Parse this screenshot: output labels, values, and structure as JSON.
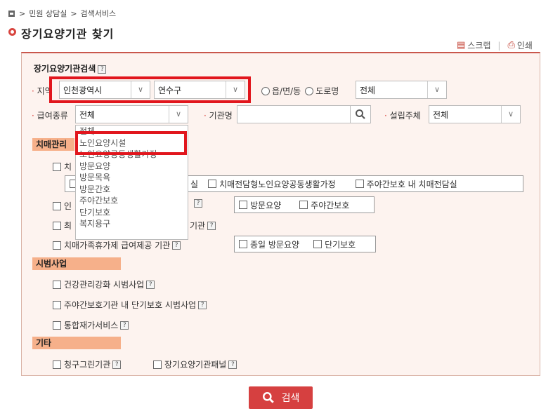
{
  "breadcrumb": {
    "home_icon": "home-icon",
    "item1": "민원 상담실",
    "item2": "검색서비스",
    "separator": ">"
  },
  "page_title": "장기요양기관 찾기",
  "tools": {
    "scrap": "스크랩",
    "print": "인쇄",
    "divider": "|"
  },
  "search_form": {
    "title": "장기요양기관검색",
    "help": "?",
    "region_label": "지역",
    "region_marker": "·",
    "sido": "인천광역시",
    "sigungu": "연수구",
    "radio_town": "읍/면/동",
    "radio_road": "도로명",
    "town_select": "전체",
    "benefit_label": "급여종류",
    "benefit_select": "전체",
    "name_label": "기관명",
    "name_value": "",
    "founder_label": "설립주체",
    "founder_select": "전체"
  },
  "benefit_options": [
    "전체",
    "노인요양시설",
    "노인요양공동생활가정",
    "방문요양",
    "방문목욕",
    "방문간호",
    "주야간보호",
    "단기보호",
    "복지용구"
  ],
  "dementia": {
    "section": "치매관리",
    "item1_prefix": "치",
    "sub_items": [
      "실",
      "치매전담형노인요양공동생활가정",
      "주야간보호 내 치매전담실"
    ],
    "item2_prefix": "인",
    "item2_options": [
      "방문요양",
      "주야간보호"
    ],
    "item3_prefix": "최",
    "item3_suffix": "기관",
    "item4": "치매가족휴가제 급여제공 기관",
    "item4_options": [
      "종일 방문요양",
      "단기보호"
    ]
  },
  "pilot": {
    "section": "시범사업",
    "items": [
      "건강관리강화 시범사업",
      "주야간보호기관 내 단기보호 시범사업",
      "통합재가서비스"
    ]
  },
  "etc": {
    "section": "기타",
    "items": [
      "청구그린기관",
      "장기요양기관패널"
    ]
  },
  "search_button": "검색",
  "colors": {
    "accent": "#d8453f",
    "section_bg": "#f6b08a",
    "panel_bg": "#fdf3ef",
    "highlight": "#e1161d"
  }
}
